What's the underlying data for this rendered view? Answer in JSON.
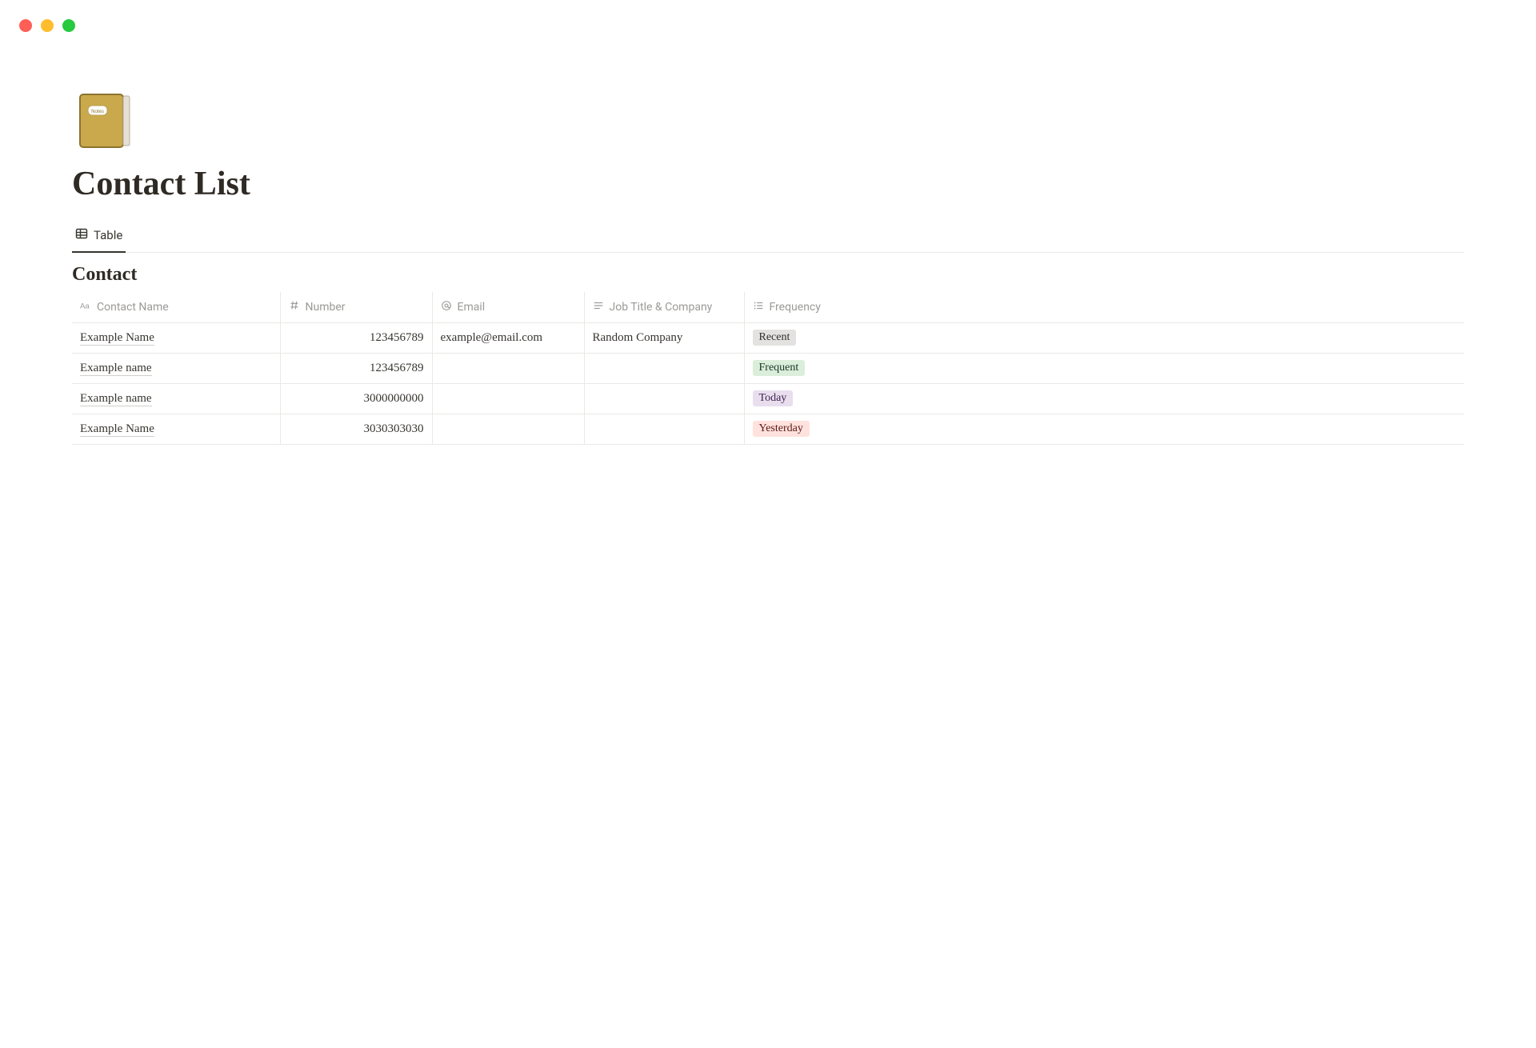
{
  "page": {
    "title": "Contact List"
  },
  "view": {
    "tab_label": "Table"
  },
  "database": {
    "title": "Contact",
    "columns": {
      "name": "Contact Name",
      "number": "Number",
      "email": "Email",
      "job": "Job Title & Company",
      "freq": "Frequency"
    },
    "rows": [
      {
        "name": "Example Name",
        "number": "123456789",
        "email": "example@email.com",
        "job": "Random Company",
        "freq": "Recent",
        "freq_color": "gray"
      },
      {
        "name": "Example name",
        "number": "123456789",
        "email": "",
        "job": "",
        "freq": "Frequent",
        "freq_color": "green"
      },
      {
        "name": "Example name",
        "number": "3000000000",
        "email": "",
        "job": "",
        "freq": "Today",
        "freq_color": "purple"
      },
      {
        "name": "Example Name",
        "number": "3030303030",
        "email": "",
        "job": "",
        "freq": "Yesterday",
        "freq_color": "red"
      }
    ]
  }
}
